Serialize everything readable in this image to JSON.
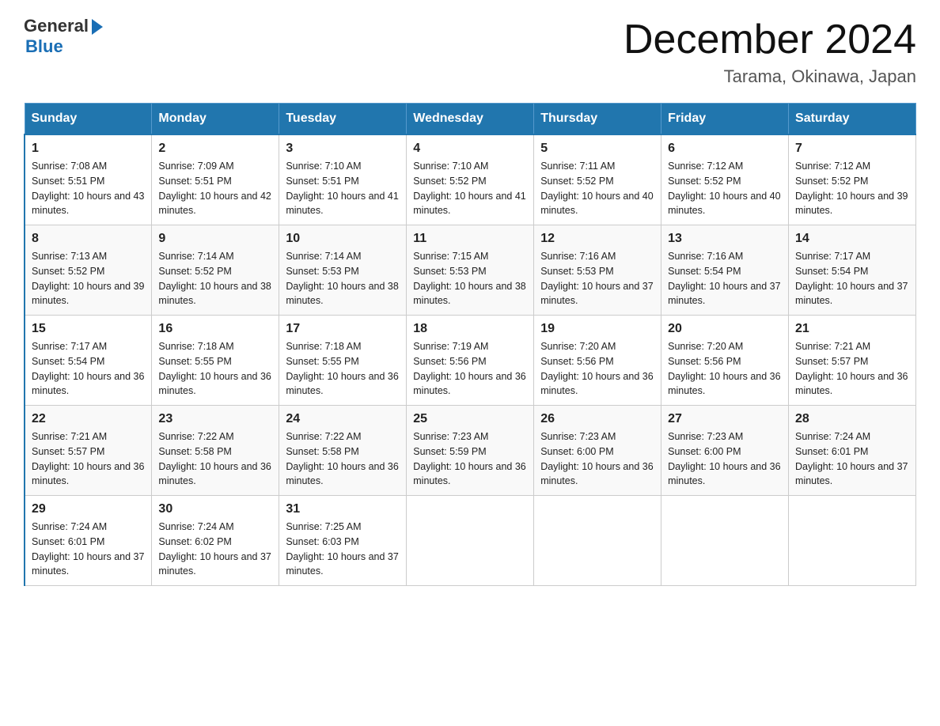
{
  "logo": {
    "general": "General",
    "blue": "Blue"
  },
  "title": {
    "month_year": "December 2024",
    "location": "Tarama, Okinawa, Japan"
  },
  "days_of_week": [
    "Sunday",
    "Monday",
    "Tuesday",
    "Wednesday",
    "Thursday",
    "Friday",
    "Saturday"
  ],
  "weeks": [
    [
      {
        "day": "1",
        "sunrise": "7:08 AM",
        "sunset": "5:51 PM",
        "daylight": "10 hours and 43 minutes."
      },
      {
        "day": "2",
        "sunrise": "7:09 AM",
        "sunset": "5:51 PM",
        "daylight": "10 hours and 42 minutes."
      },
      {
        "day": "3",
        "sunrise": "7:10 AM",
        "sunset": "5:51 PM",
        "daylight": "10 hours and 41 minutes."
      },
      {
        "day": "4",
        "sunrise": "7:10 AM",
        "sunset": "5:52 PM",
        "daylight": "10 hours and 41 minutes."
      },
      {
        "day": "5",
        "sunrise": "7:11 AM",
        "sunset": "5:52 PM",
        "daylight": "10 hours and 40 minutes."
      },
      {
        "day": "6",
        "sunrise": "7:12 AM",
        "sunset": "5:52 PM",
        "daylight": "10 hours and 40 minutes."
      },
      {
        "day": "7",
        "sunrise": "7:12 AM",
        "sunset": "5:52 PM",
        "daylight": "10 hours and 39 minutes."
      }
    ],
    [
      {
        "day": "8",
        "sunrise": "7:13 AM",
        "sunset": "5:52 PM",
        "daylight": "10 hours and 39 minutes."
      },
      {
        "day": "9",
        "sunrise": "7:14 AM",
        "sunset": "5:52 PM",
        "daylight": "10 hours and 38 minutes."
      },
      {
        "day": "10",
        "sunrise": "7:14 AM",
        "sunset": "5:53 PM",
        "daylight": "10 hours and 38 minutes."
      },
      {
        "day": "11",
        "sunrise": "7:15 AM",
        "sunset": "5:53 PM",
        "daylight": "10 hours and 38 minutes."
      },
      {
        "day": "12",
        "sunrise": "7:16 AM",
        "sunset": "5:53 PM",
        "daylight": "10 hours and 37 minutes."
      },
      {
        "day": "13",
        "sunrise": "7:16 AM",
        "sunset": "5:54 PM",
        "daylight": "10 hours and 37 minutes."
      },
      {
        "day": "14",
        "sunrise": "7:17 AM",
        "sunset": "5:54 PM",
        "daylight": "10 hours and 37 minutes."
      }
    ],
    [
      {
        "day": "15",
        "sunrise": "7:17 AM",
        "sunset": "5:54 PM",
        "daylight": "10 hours and 36 minutes."
      },
      {
        "day": "16",
        "sunrise": "7:18 AM",
        "sunset": "5:55 PM",
        "daylight": "10 hours and 36 minutes."
      },
      {
        "day": "17",
        "sunrise": "7:18 AM",
        "sunset": "5:55 PM",
        "daylight": "10 hours and 36 minutes."
      },
      {
        "day": "18",
        "sunrise": "7:19 AM",
        "sunset": "5:56 PM",
        "daylight": "10 hours and 36 minutes."
      },
      {
        "day": "19",
        "sunrise": "7:20 AM",
        "sunset": "5:56 PM",
        "daylight": "10 hours and 36 minutes."
      },
      {
        "day": "20",
        "sunrise": "7:20 AM",
        "sunset": "5:56 PM",
        "daylight": "10 hours and 36 minutes."
      },
      {
        "day": "21",
        "sunrise": "7:21 AM",
        "sunset": "5:57 PM",
        "daylight": "10 hours and 36 minutes."
      }
    ],
    [
      {
        "day": "22",
        "sunrise": "7:21 AM",
        "sunset": "5:57 PM",
        "daylight": "10 hours and 36 minutes."
      },
      {
        "day": "23",
        "sunrise": "7:22 AM",
        "sunset": "5:58 PM",
        "daylight": "10 hours and 36 minutes."
      },
      {
        "day": "24",
        "sunrise": "7:22 AM",
        "sunset": "5:58 PM",
        "daylight": "10 hours and 36 minutes."
      },
      {
        "day": "25",
        "sunrise": "7:23 AM",
        "sunset": "5:59 PM",
        "daylight": "10 hours and 36 minutes."
      },
      {
        "day": "26",
        "sunrise": "7:23 AM",
        "sunset": "6:00 PM",
        "daylight": "10 hours and 36 minutes."
      },
      {
        "day": "27",
        "sunrise": "7:23 AM",
        "sunset": "6:00 PM",
        "daylight": "10 hours and 36 minutes."
      },
      {
        "day": "28",
        "sunrise": "7:24 AM",
        "sunset": "6:01 PM",
        "daylight": "10 hours and 37 minutes."
      }
    ],
    [
      {
        "day": "29",
        "sunrise": "7:24 AM",
        "sunset": "6:01 PM",
        "daylight": "10 hours and 37 minutes."
      },
      {
        "day": "30",
        "sunrise": "7:24 AM",
        "sunset": "6:02 PM",
        "daylight": "10 hours and 37 minutes."
      },
      {
        "day": "31",
        "sunrise": "7:25 AM",
        "sunset": "6:03 PM",
        "daylight": "10 hours and 37 minutes."
      },
      null,
      null,
      null,
      null
    ]
  ]
}
